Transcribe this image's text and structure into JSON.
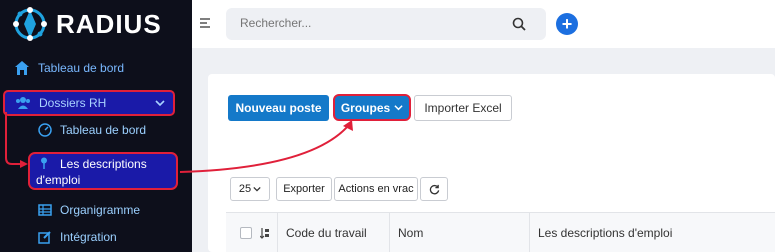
{
  "app": {
    "name": "RADIUS"
  },
  "sidebar": {
    "dashboard": "Tableau de bord",
    "dossiers": "Dossiers RH",
    "sub": {
      "dashboard": "Tableau de bord",
      "descriptions_line1": "Les descriptions",
      "descriptions_line2": "d'emploi",
      "organigramme": "Organigramme",
      "integration": "Intégration"
    }
  },
  "topbar": {
    "search_placeholder": "Rechercher...",
    "add": "+"
  },
  "toolbar": {
    "new_post": "Nouveau poste",
    "groups": "Groupes",
    "import": "Importer Excel"
  },
  "table_controls": {
    "page_size": "25",
    "export": "Exporter",
    "bulk": "Actions en vrac"
  },
  "table": {
    "columns": [
      "Code du travail",
      "Nom",
      "Les descriptions d'emploi"
    ]
  },
  "colors": {
    "accent": "#1479c9",
    "highlight": "#e0203a",
    "sidebar_bg": "#0d0f1b"
  }
}
